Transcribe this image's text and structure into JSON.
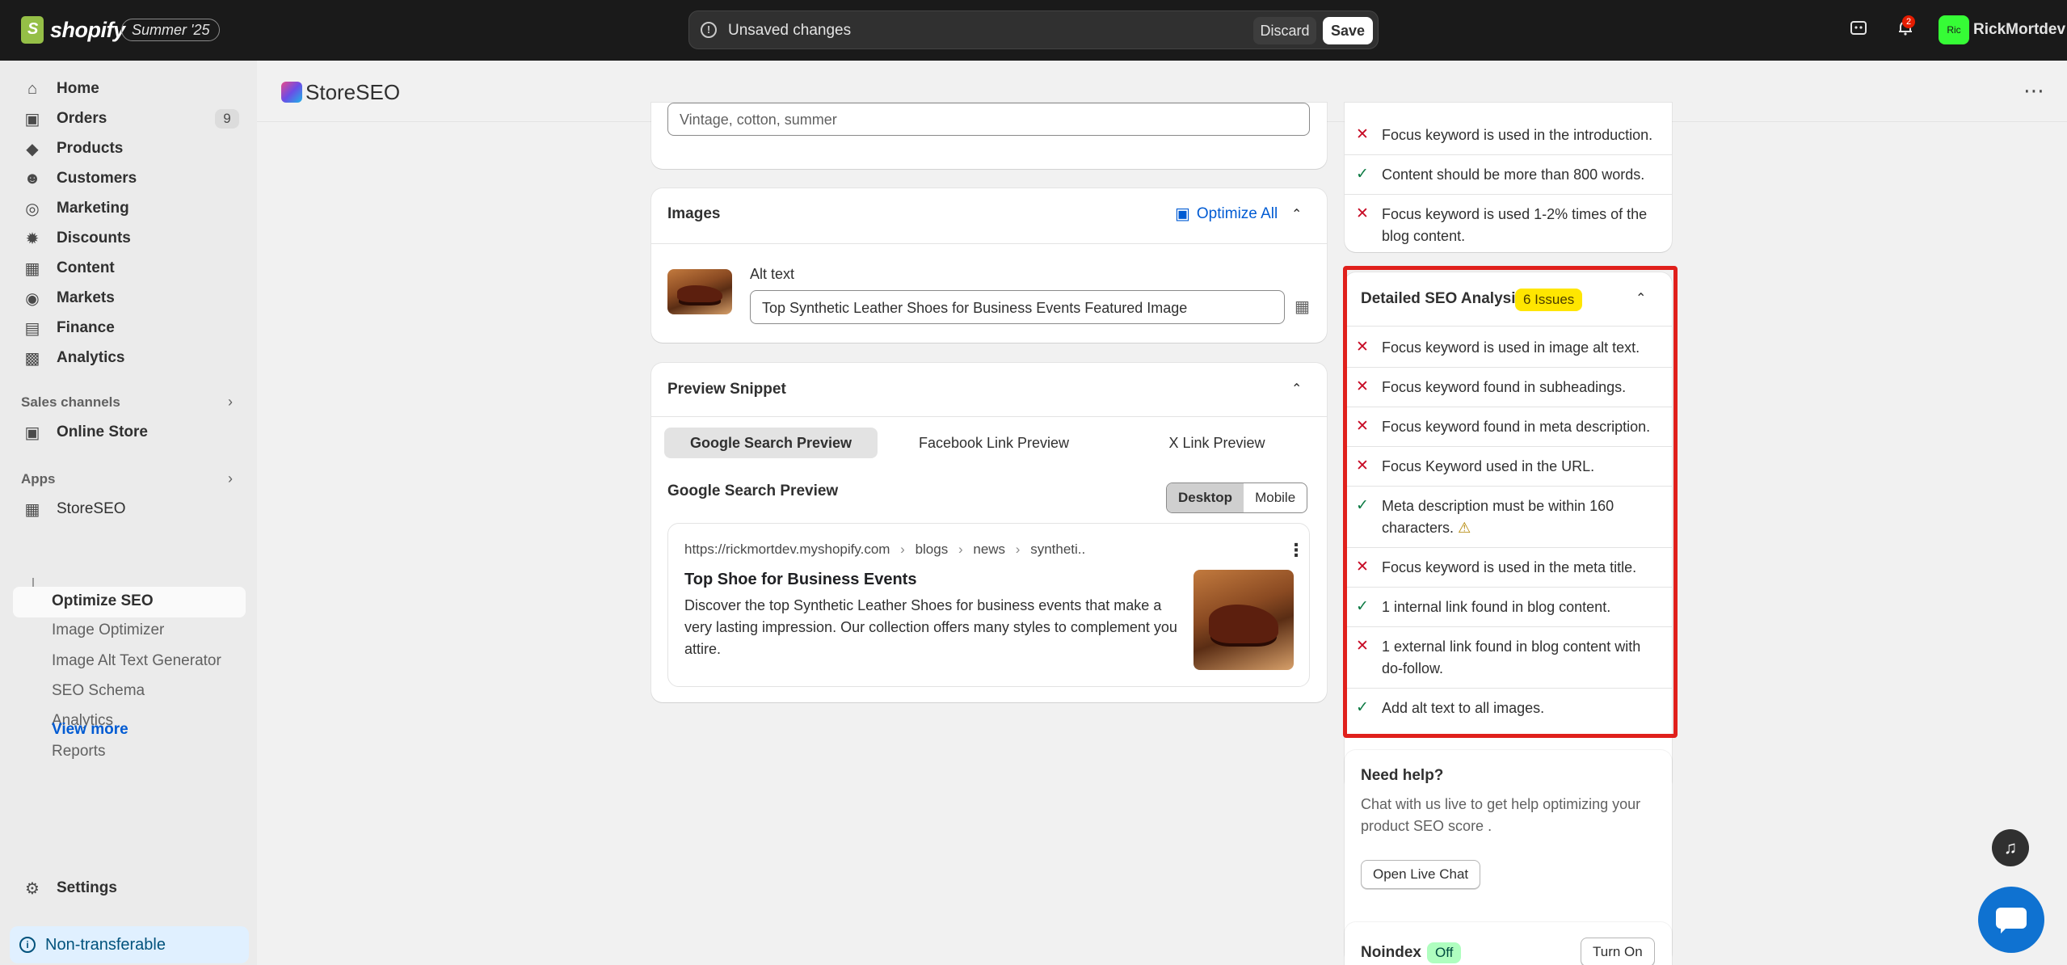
{
  "topbar": {
    "brand": "shopify",
    "edition_badge": "Summer '25",
    "unsaved_message": "Unsaved changes",
    "discard_label": "Discard",
    "save_label": "Save",
    "notification_count": "2",
    "avatar_initials": "Ric",
    "username": "RickMortdev"
  },
  "sidebar": {
    "items": [
      {
        "label": "Home",
        "icon": "home-icon"
      },
      {
        "label": "Orders",
        "icon": "inbox-icon",
        "count": "9"
      },
      {
        "label": "Products",
        "icon": "tag-icon"
      },
      {
        "label": "Customers",
        "icon": "person-icon"
      },
      {
        "label": "Marketing",
        "icon": "target-icon"
      },
      {
        "label": "Discounts",
        "icon": "discount-icon"
      },
      {
        "label": "Content",
        "icon": "content-icon"
      },
      {
        "label": "Markets",
        "icon": "globe-icon"
      },
      {
        "label": "Finance",
        "icon": "bank-icon"
      },
      {
        "label": "Analytics",
        "icon": "chart-icon"
      }
    ],
    "sales_channels_heading": "Sales channels",
    "online_store": "Online Store",
    "apps_heading": "Apps",
    "app_name": "StoreSEO",
    "app_subitems": [
      "Optimize SEO",
      "Image Optimizer",
      "Image Alt Text Generator",
      "SEO Schema",
      "Analytics",
      "Reports"
    ],
    "view_more": "View more",
    "settings": "Settings",
    "non_transferable": "Non-transferable"
  },
  "app_header": {
    "title": "StoreSEO"
  },
  "tags_field": {
    "value": "Vintage, cotton, summer"
  },
  "images_card": {
    "title": "Images",
    "optimize_all": "Optimize All",
    "alt_text_label": "Alt text",
    "alt_text_value": "Top Synthetic Leather Shoes for Business Events Featured Image"
  },
  "preview_card": {
    "title": "Preview Snippet",
    "tabs": [
      "Google Search Preview",
      "Facebook Link Preview",
      "X Link Preview"
    ],
    "subtitle": "Google Search Preview",
    "device_options": [
      "Desktop",
      "Mobile"
    ],
    "serp": {
      "url": "https://rickmortdev.myshopify.com",
      "crumbs": [
        "blogs",
        "news",
        "syntheti.."
      ],
      "title": "Top Shoe for Business Events",
      "description": "Discover the top Synthetic Leather Shoes for business events that make a very lasting impression. Our collection offers many styles to complement you attire."
    }
  },
  "basic_checks": [
    {
      "status": "fail",
      "text": "Focus keyword is used in the introduction."
    },
    {
      "status": "pass",
      "text": "Content should be more than 800 words."
    },
    {
      "status": "fail",
      "text": "Focus keyword is used 1-2% times of the blog content."
    }
  ],
  "detailed_analysis": {
    "title": "Detailed SEO Analysis",
    "issues_badge": "6 Issues",
    "checks": [
      {
        "status": "fail",
        "text": "Focus keyword is used in image alt text."
      },
      {
        "status": "fail",
        "text": "Focus keyword found in subheadings."
      },
      {
        "status": "fail",
        "text": "Focus keyword found in meta description."
      },
      {
        "status": "fail",
        "text": "Focus Keyword used in the URL."
      },
      {
        "status": "pass",
        "text": "Meta description must be within 160 characters."
      },
      {
        "status": "fail",
        "text": "Focus keyword is used in the meta title."
      },
      {
        "status": "pass",
        "text": "1 internal link found in blog content."
      },
      {
        "status": "fail",
        "text": "1 external link found in blog content with do-follow."
      },
      {
        "status": "pass",
        "text": "Add alt text to all images."
      }
    ]
  },
  "help_card": {
    "title": "Need help?",
    "text": "Chat with us live to get help optimizing your product SEO score .",
    "button": "Open Live Chat"
  },
  "noindex_card": {
    "title": "Noindex",
    "status": "Off",
    "button": "Turn On"
  },
  "colors": {
    "fail": "#c70a24",
    "pass": "#0c7a43",
    "highlight": "#e0201c",
    "link": "#005bd3",
    "issues_badge": "#ffe600"
  }
}
